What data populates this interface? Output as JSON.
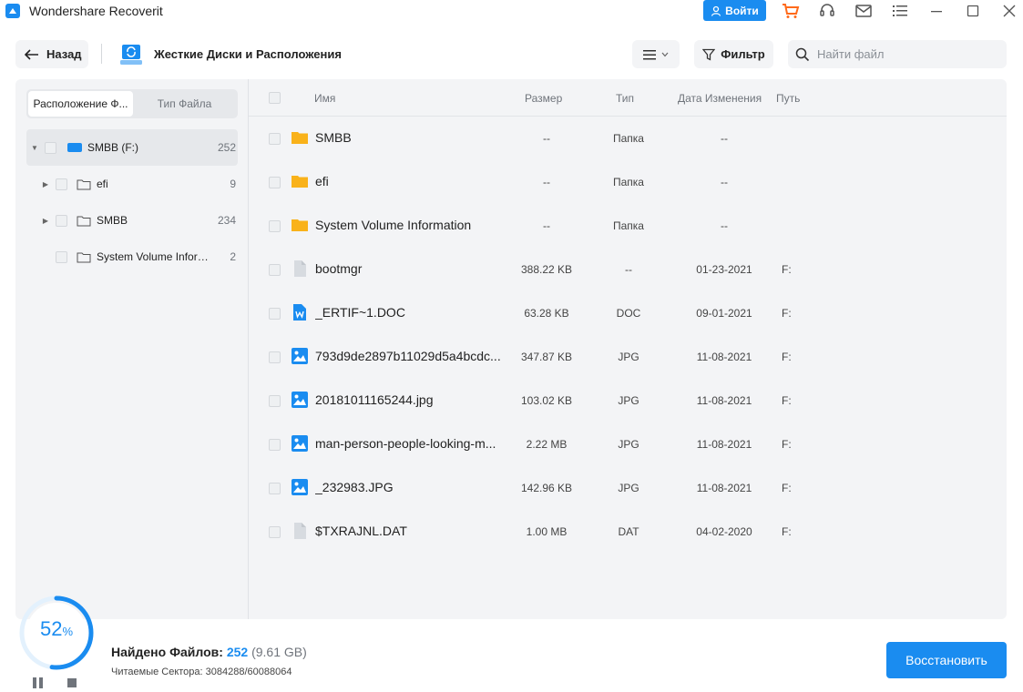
{
  "app": {
    "title": "Wondershare Recoverit",
    "login_label": "Войти"
  },
  "toolbar": {
    "back_label": "Назад",
    "location_title": "Жесткие Диски и Расположения",
    "filter_label": "Фильтр",
    "search_placeholder": "Найти файл"
  },
  "sidebar": {
    "tabs": [
      "Расположение Ф...",
      "Тип Файла"
    ],
    "tree": [
      {
        "label": "SMBB (F:)",
        "count": "252"
      },
      {
        "label": "efi",
        "count": "9"
      },
      {
        "label": "SMBB",
        "count": "234"
      },
      {
        "label": "System Volume Inform...",
        "count": "2"
      }
    ]
  },
  "table": {
    "headers": {
      "name": "Имя",
      "size": "Размер",
      "type": "Тип",
      "modified": "Дата Изменения",
      "path": "Путь"
    },
    "rows": [
      {
        "name": "SMBB",
        "size": "--",
        "type": "Папка",
        "date": "--",
        "path": "",
        "icon": "folder-icon"
      },
      {
        "name": "efi",
        "size": "--",
        "type": "Папка",
        "date": "--",
        "path": "",
        "icon": "folder-icon"
      },
      {
        "name": "System Volume Information",
        "size": "--",
        "type": "Папка",
        "date": "--",
        "path": "",
        "icon": "folder-icon"
      },
      {
        "name": "bootmgr",
        "size": "388.22 KB",
        "type": "--",
        "date": "01-23-2021",
        "path": "F:",
        "icon": "file-icon"
      },
      {
        "name": "_ERTIF~1.DOC",
        "size": "63.28 KB",
        "type": "DOC",
        "date": "09-01-2021",
        "path": "F:",
        "icon": "word-doc-icon"
      },
      {
        "name": "793d9de2897b11029d5a4bcdc...",
        "size": "347.87 KB",
        "type": "JPG",
        "date": "11-08-2021",
        "path": "F:",
        "icon": "image-icon"
      },
      {
        "name": "20181011165244.jpg",
        "size": "103.02 KB",
        "type": "JPG",
        "date": "11-08-2021",
        "path": "F:",
        "icon": "image-icon"
      },
      {
        "name": "man-person-people-looking-m...",
        "size": "2.22 MB",
        "type": "JPG",
        "date": "11-08-2021",
        "path": "F:",
        "icon": "image-icon"
      },
      {
        "name": "_232983.JPG",
        "size": "142.96 KB",
        "type": "JPG",
        "date": "11-08-2021",
        "path": "F:",
        "icon": "image-icon"
      },
      {
        "name": "$TXRAJNL.DAT",
        "size": "1.00 MB",
        "type": "DAT",
        "date": "04-02-2020",
        "path": "F:",
        "icon": "file-icon"
      }
    ]
  },
  "status": {
    "progress_value": "52",
    "progress_unit": "%",
    "found_label": "Найдено Файлов:",
    "found_count": "252",
    "found_size": "(9.61 GB)",
    "sectors_label": "Читаемые Сектора:",
    "sectors_value": "3084288/60088064",
    "recover_label": "Восстановить"
  },
  "colors": {
    "accent": "#1a8cf0",
    "folder": "#f9b21a",
    "cart": "#ff6a1a"
  }
}
